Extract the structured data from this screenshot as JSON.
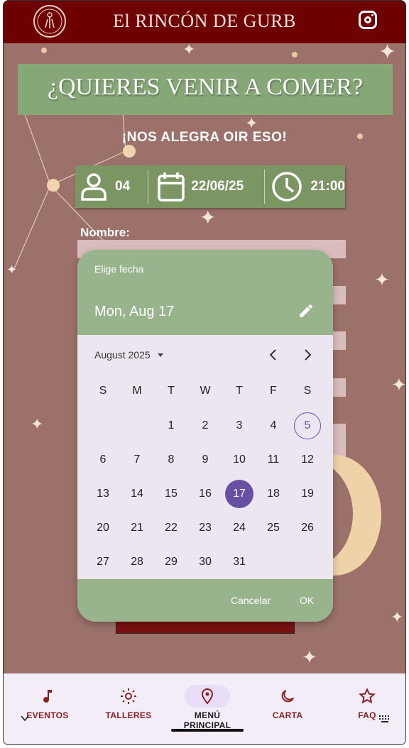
{
  "app": {
    "title": "El RINCÓN DE GURB"
  },
  "header": {
    "question": "¿QUIERES VENIR A COMER?",
    "subtitle": "¡NOS ALEGRA OIR ESO!"
  },
  "reservation": {
    "guests": "04",
    "date": "22/06/25",
    "time": "21:00"
  },
  "form": {
    "name_label": "Nombre:"
  },
  "date_picker": {
    "caption": "Elige fecha",
    "selected_label": "Mon, Aug 17",
    "month_label": "August 2025",
    "weekdays": [
      "S",
      "M",
      "T",
      "W",
      "T",
      "F",
      "S"
    ],
    "leading_blanks": 2,
    "days": [
      "1",
      "2",
      "3",
      "4",
      "5",
      "6",
      "7",
      "8",
      "9",
      "10",
      "11",
      "12",
      "13",
      "14",
      "15",
      "16",
      "17",
      "18",
      "19",
      "20",
      "21",
      "22",
      "23",
      "24",
      "25",
      "26",
      "27",
      "28",
      "29",
      "30",
      "31"
    ],
    "today": "5",
    "selected": "17",
    "cancel_label": "Cancelar",
    "ok_label": "OK"
  },
  "nav": {
    "items": [
      {
        "label": "EVENTOS",
        "icon": "music-note-icon"
      },
      {
        "label": "TALLERES",
        "icon": "sun-icon"
      },
      {
        "label": "MENÚ PRINCIPAL",
        "icon": "location-pin-icon"
      },
      {
        "label": "CARTA",
        "icon": "moon-icon"
      },
      {
        "label": "FAQ",
        "icon": "star-icon"
      }
    ]
  },
  "colors": {
    "brand": "#6e0000",
    "banner": "#86a877",
    "picker_accent": "#6750a4",
    "background": "#9b7169"
  }
}
